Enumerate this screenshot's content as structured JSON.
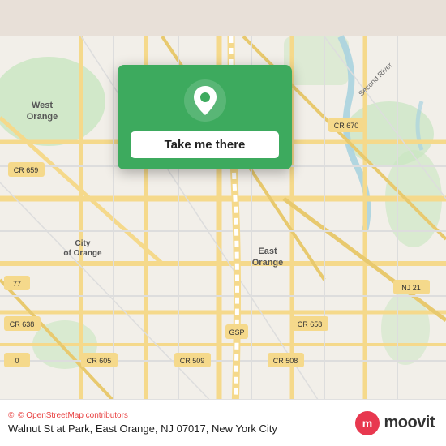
{
  "map": {
    "attribution": "© OpenStreetMap contributors",
    "attribution_symbol": "©"
  },
  "card": {
    "button_label": "Take me there"
  },
  "bottom_bar": {
    "attribution": "© OpenStreetMap contributors",
    "location_text": "Walnut St at Park, East Orange, NJ 07017, New York City"
  },
  "brand": {
    "name": "moovit"
  },
  "icons": {
    "pin": "location-pin-icon",
    "osm_heart": "heart-icon"
  }
}
